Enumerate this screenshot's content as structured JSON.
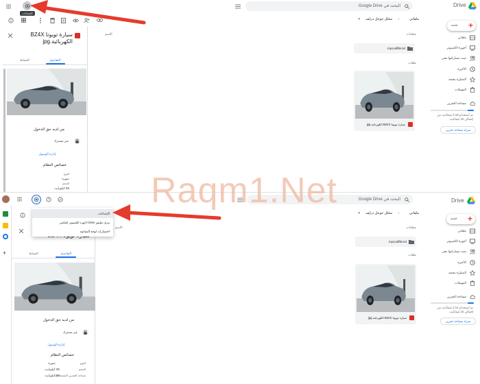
{
  "app": {
    "logo_text": "Drive",
    "search_placeholder": "البحث في Google Drive",
    "tooltip_settings": "الإعدادات"
  },
  "nav": {
    "new_label": "جديد",
    "items": [
      {
        "label": "ملفاتي",
        "icon": "drive-icon"
      },
      {
        "label": "أجهزة الكمبيوتر",
        "icon": "computer-icon"
      },
      {
        "label": "تمت مشاركتها معي",
        "icon": "people-icon"
      },
      {
        "label": "الأخيرة",
        "icon": "clock-icon"
      },
      {
        "label": "المميّزة بنجمة",
        "icon": "star-icon"
      },
      {
        "label": "المهملات",
        "icon": "trash-icon"
      }
    ],
    "storage_label": "مساحة التخزين",
    "storage_used_top": "تم استخدام 2.18 غيغابايت من إجمالي 15 غيغابايت",
    "storage_used_bottom": "تم استخدام 2.14 غيغابايت من إجمالي 15 غيغابايت",
    "storage_fraction": 0.145,
    "buy_storage": "شراء مساحة تخزين"
  },
  "main": {
    "breadcrumb_root": "ملفاتي",
    "breadcrumb_folder": "محلل جوجل درايف",
    "folders_label": "مجلدات",
    "files_label": "ملفات",
    "folder_name": "mycoolfile.txt",
    "file_name": "سيارة تويوتا BZ4X الكهربائية.jpg",
    "name_col": "الاسم"
  },
  "details": {
    "title": "سيارة تويوتا BZ4X الكهربائية.jpg",
    "tab_details": "التفاصيل",
    "tab_activity": "النشاط",
    "access_heading": "من لديه حق الدخول",
    "not_shared": "غير مشترك",
    "manage_access": "إدارة الوصول",
    "properties_heading": "خصائص النظام",
    "type_label": "النوع",
    "type_value": "صورة",
    "size_label": "الحجم",
    "size_value": "85 كيلوبايت",
    "storage_used_label": "مساحة التخزين المستخدمة",
    "storage_used_value": "85 كيلوبايت"
  },
  "settings_menu": {
    "items": [
      "الإعدادات",
      "تنزيل تطبيق Drive لأجهزة الكمبيوتر المكتبي",
      "اختصارات لوحة المفاتيح"
    ]
  },
  "watermark": "Raqm1.Net",
  "colors": {
    "accent": "#1a73e8",
    "arrow": "#e53b2c",
    "red_file": "#d93025",
    "search_bg": "#f1f3f4"
  }
}
